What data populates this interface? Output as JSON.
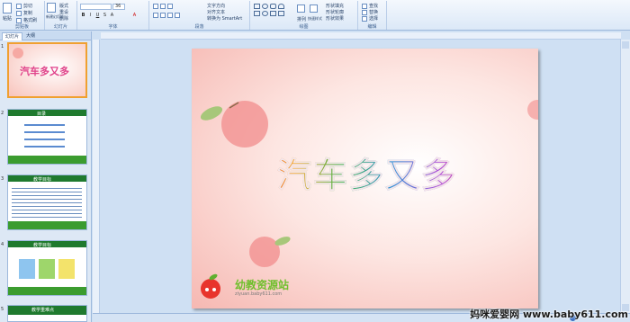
{
  "ribbon": {
    "groups": [
      {
        "label": "剪贴板"
      },
      {
        "label": "幻灯片"
      },
      {
        "label": "字体"
      },
      {
        "label": "段落"
      },
      {
        "label": "绘图"
      },
      {
        "label": "编辑"
      }
    ],
    "clipboard": {
      "paste": "粘贴",
      "cut": "剪切",
      "copy": "复制",
      "format": "格式刷"
    },
    "slides": {
      "new_slide": "新建幻灯片",
      "layout": "版式",
      "reset": "重设",
      "delete": "删除"
    },
    "font": {
      "font_name": "",
      "font_size": "36",
      "bold": "B",
      "italic": "I",
      "underline": "U",
      "strike": "S",
      "shadow": "A",
      "color": "A"
    },
    "paragraph": {
      "text_direction": "文字方向",
      "align_text": "对齐文本",
      "smartart": "转换为 SmartArt"
    },
    "drawing": {
      "arrange": "排列",
      "quick_styles": "快速样式",
      "fill": "形状填充",
      "outline": "形状轮廓",
      "effects": "形状效果"
    },
    "editing": {
      "find": "查找",
      "replace": "替换",
      "select": "选择"
    }
  },
  "pane": {
    "tabs": [
      "幻灯片",
      "大纲"
    ],
    "slides": [
      {
        "number": "1",
        "title": "汽车多又多"
      },
      {
        "number": "2",
        "title": "目录"
      },
      {
        "number": "3",
        "title": "教学目标"
      },
      {
        "number": "4",
        "title": "教学目标"
      },
      {
        "number": "5",
        "title": "教学重难点"
      }
    ]
  },
  "slide": {
    "title": "汽车多又多",
    "logo_text": "幼教资源站",
    "logo_url": "ziyuan.baby611.com"
  },
  "watermark": "妈咪爱婴网 www.baby611.com",
  "colors": {
    "ribbon_bg": "#dbe8f7",
    "accent_selected": "#f0a030",
    "slide_pink": "#f6b8b2",
    "logo_green": "#6fbf2c"
  }
}
